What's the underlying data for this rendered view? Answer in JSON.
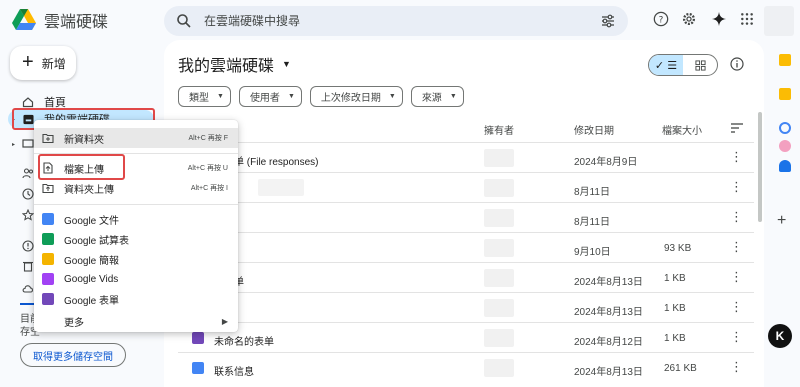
{
  "app": {
    "title": "雲端硬碟"
  },
  "search": {
    "placeholder": "在雲端硬碟中搜尋"
  },
  "nav": {
    "new_label": "新增",
    "home_label": "首頁",
    "mydrive_label": "我的雲端硬碟",
    "storage_prefix1": "目前",
    "storage_prefix2": "存空",
    "storage_button": "取得更多儲存空間"
  },
  "main": {
    "title": "我的雲端硬碟",
    "filters": [
      "類型",
      "使用者",
      "上次修改日期",
      "來源"
    ],
    "columns": {
      "owner": "擁有者",
      "modified": "修改日期",
      "size": "檔案大小"
    },
    "rows": [
      {
        "name": "的表单 (File responses)",
        "date": "2024年8月9日",
        "size": ""
      },
      {
        "name": "",
        "date": "8月11日",
        "size": ""
      },
      {
        "name": "",
        "date": "8月11日",
        "size": ""
      },
      {
        "name": "",
        "date": "9月10日",
        "size": "93 KB"
      },
      {
        "name": "的表单",
        "date": "2024年8月13日",
        "size": "1 KB"
      },
      {
        "name": "",
        "date": "2024年8月13日",
        "size": "1 KB"
      },
      {
        "name": "未命名的表单",
        "date": "2024年8月12日",
        "size": "1 KB"
      },
      {
        "name": "联系信息",
        "date": "2024年8月13日",
        "size": "261 KB"
      }
    ]
  },
  "menu": {
    "new_folder": {
      "label": "新資料夾",
      "shortcut": "Alt+C 再按 F"
    },
    "file_upload": {
      "label": "檔案上傳",
      "shortcut": "Alt+C 再按 U"
    },
    "folder_upload": {
      "label": "資料夾上傳",
      "shortcut": "Alt+C 再按 I"
    },
    "google_docs": "Google 文件",
    "google_sheets": "Google 試算表",
    "google_slides": "Google 簡報",
    "google_vids": "Google Vids",
    "google_forms": "Google 表單",
    "more": "更多"
  },
  "badge": {
    "letter": "K"
  },
  "colors": {
    "accent": "#0b57d0",
    "selected": "#c2e7ff",
    "highlight": "#e04848"
  }
}
